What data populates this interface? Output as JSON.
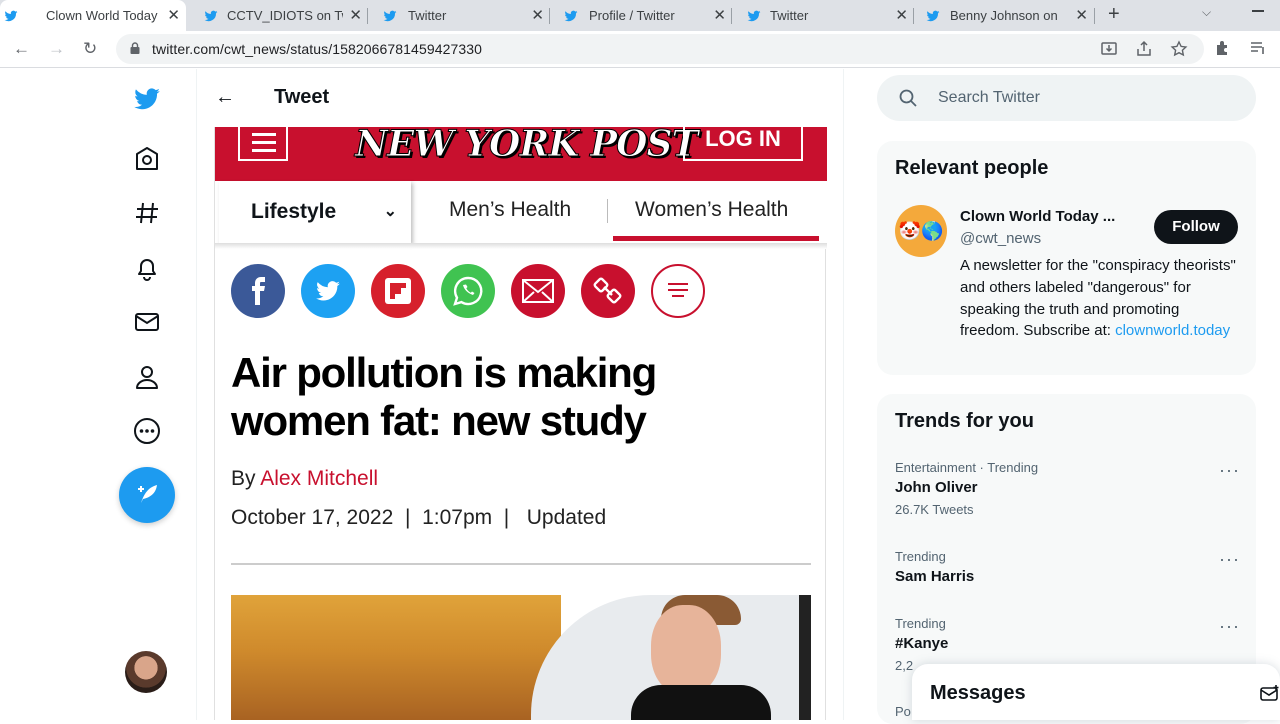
{
  "browser": {
    "tabs": [
      {
        "title": "Clown World Today",
        "active": true
      },
      {
        "title": "CCTV_IDIOTS on Tw",
        "active": false
      },
      {
        "title": "Twitter",
        "active": false
      },
      {
        "title": "Profile / Twitter",
        "active": false
      },
      {
        "title": "Twitter",
        "active": false
      },
      {
        "title": "Benny Johnson on",
        "active": false
      }
    ],
    "url": "twitter.com/cwt_news/status/1582066781459427330"
  },
  "header": {
    "title": "Tweet"
  },
  "article": {
    "masthead": "NEW YORK POST",
    "login_label": "LOG IN",
    "section": "Lifestyle",
    "tabs": [
      "Men’s Health",
      "Women’s Health"
    ],
    "headline": "Air pollution is making women fat: new study",
    "by_label": "By",
    "author": "Alex Mitchell",
    "date": "October 17, 2022",
    "time": "1:07pm",
    "updated": "Updated"
  },
  "search": {
    "placeholder": "Search Twitter"
  },
  "relevant": {
    "title": "Relevant people",
    "name": "Clown World Today ...",
    "handle": "@cwt_news",
    "follow_label": "Follow",
    "bio": "A newsletter for the \"conspiracy theorists\" and others labeled \"dangerous\" for speaking the truth and promoting freedom. Subscribe at:",
    "link": "clownworld.today"
  },
  "trends": {
    "title": "Trends for you",
    "items": [
      {
        "meta": "Entertainment · Trending",
        "name": "John Oliver",
        "count": "26.7K Tweets"
      },
      {
        "meta": "Trending",
        "name": "Sam Harris",
        "count": ""
      },
      {
        "meta": "Trending",
        "name": "#Kanye",
        "count": "2,2"
      },
      {
        "meta": "Po",
        "name": "",
        "count": ""
      }
    ]
  },
  "messages": {
    "title": "Messages"
  },
  "colors": {
    "twitter_blue": "#1d9bf0",
    "nyp_red": "#c8102e"
  }
}
